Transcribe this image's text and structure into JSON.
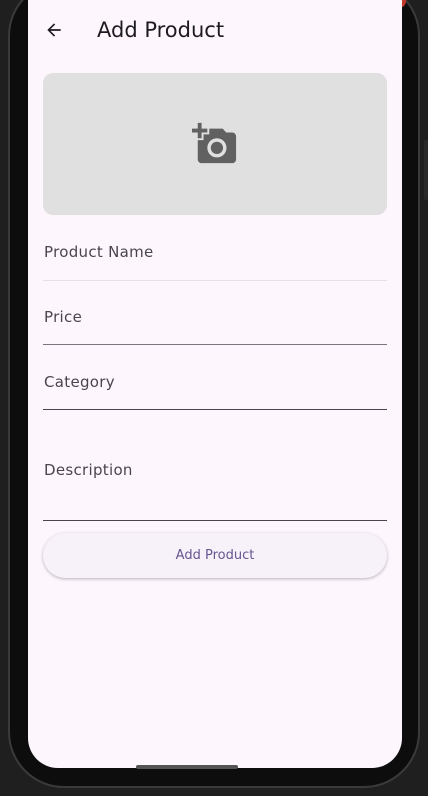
{
  "app_bar": {
    "title": "Add Product",
    "back_icon": "arrow-back-icon"
  },
  "image_picker": {
    "icon": "add-a-photo-icon",
    "background": "#e0e0e0",
    "icon_color": "#616161"
  },
  "form": {
    "fields": [
      {
        "label": "Product Name"
      },
      {
        "label": "Price"
      },
      {
        "label": "Category"
      },
      {
        "label": "Description"
      }
    ],
    "submit_label": "Add Product"
  },
  "colors": {
    "background": "#fdf7fd",
    "primary": "#65558f",
    "text": "#1d1b20"
  }
}
